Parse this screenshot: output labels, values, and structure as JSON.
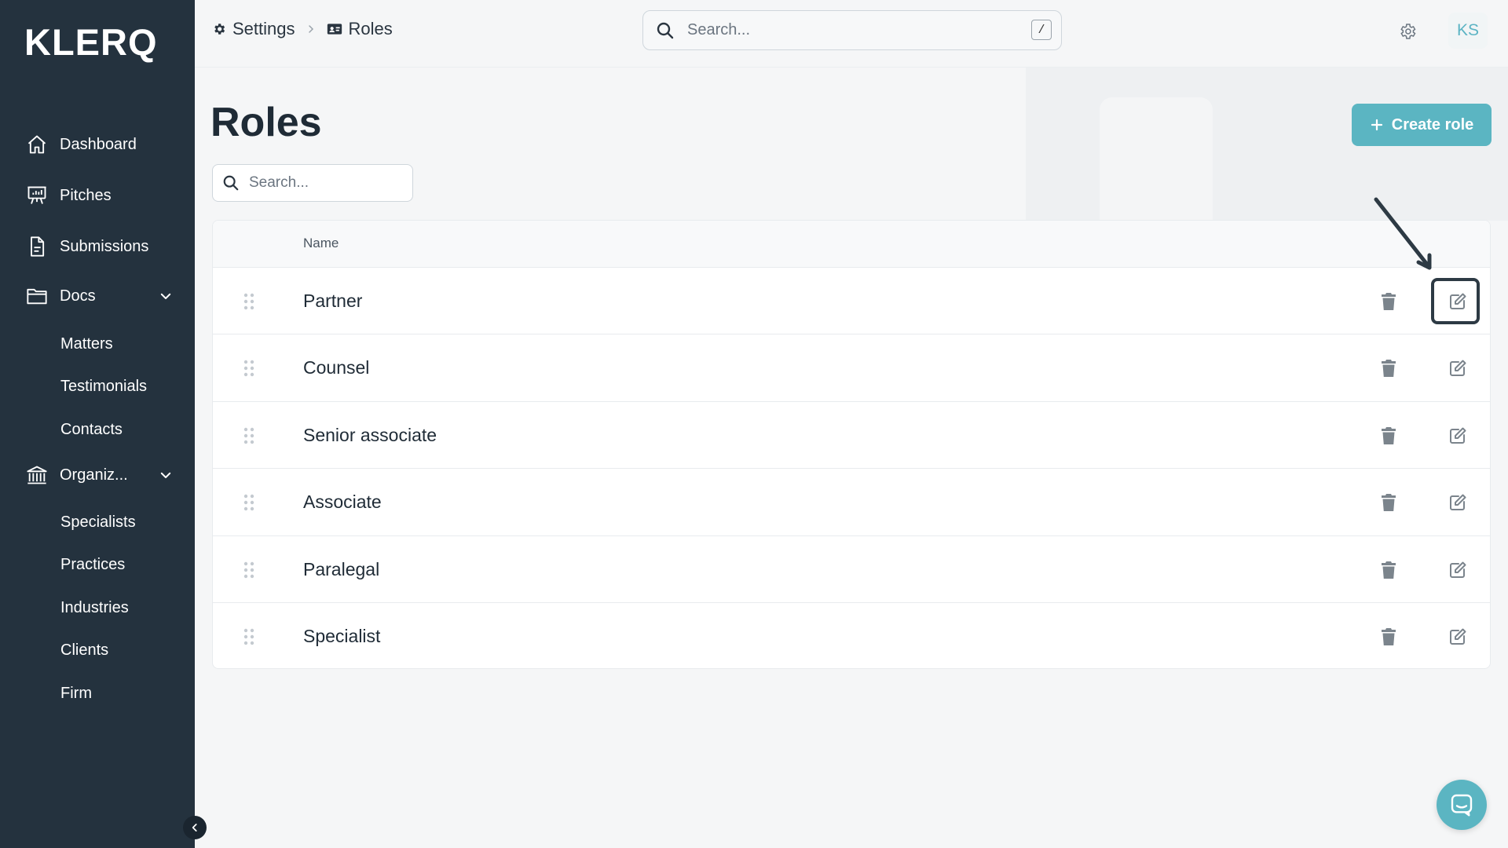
{
  "app": {
    "logo": "KLERQ"
  },
  "sidebar": {
    "items": [
      {
        "label": "Dashboard",
        "icon": "home-icon"
      },
      {
        "label": "Pitches",
        "icon": "presentation-icon"
      },
      {
        "label": "Submissions",
        "icon": "document-icon"
      },
      {
        "label": "Docs",
        "icon": "folder-icon",
        "expanded": true
      },
      {
        "label": "Organiz...",
        "icon": "bank-icon",
        "expanded": true
      }
    ],
    "docs_children": [
      "Matters",
      "Testimonials",
      "Contacts"
    ],
    "org_children": [
      "Specialists",
      "Practices",
      "Industries",
      "Clients",
      "Firm"
    ]
  },
  "topbar": {
    "breadcrumb": [
      "Settings",
      "Roles"
    ],
    "search_placeholder": "Search...",
    "search_shortcut": "/",
    "avatar_initials": "KS"
  },
  "main": {
    "title": "Roles",
    "create_label": "Create role",
    "search_placeholder": "Search...",
    "table": {
      "column_name": "Name",
      "rows": [
        "Partner",
        "Counsel",
        "Senior associate",
        "Associate",
        "Paralegal",
        "Specialist"
      ]
    }
  },
  "colors": {
    "sidebar_bg": "#24323e",
    "accent": "#5bb5c2",
    "page_bg": "#f5f6f7"
  }
}
